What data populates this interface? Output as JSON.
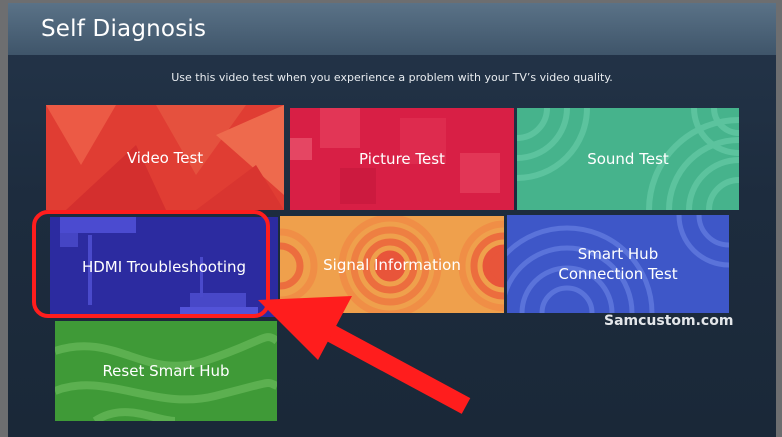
{
  "screen": {
    "title": "Self Diagnosis",
    "subtitle": "Use this video test when you experience a problem with your TV’s video quality."
  },
  "tiles": [
    {
      "label": "Video Test",
      "color": "#e03d33"
    },
    {
      "label": "Picture Test",
      "color": "#d81f45"
    },
    {
      "label": "Sound Test",
      "color": "#46b38c"
    },
    {
      "label": "HDMI Troubleshooting",
      "color": "#2c2ba0"
    },
    {
      "label": "Signal Information",
      "color": "#efa04c"
    },
    {
      "label": "Smart Hub Connection Test",
      "color": "#3e57c8"
    },
    {
      "label": "Reset Smart Hub",
      "color": "#3f9a37"
    }
  ],
  "watermark": "Samcustom.com",
  "annotation": {
    "highlight_color": "#ff1d1d",
    "target": "HDMI Troubleshooting",
    "arrow_icon": "arrow-pointer-icon"
  }
}
